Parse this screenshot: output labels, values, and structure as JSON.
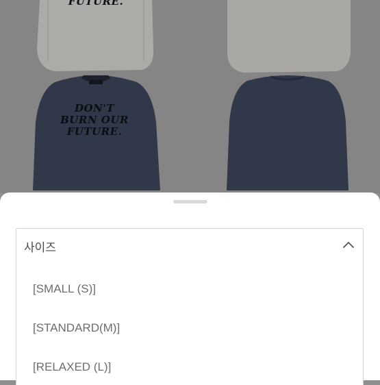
{
  "product_images": {
    "print_lines": [
      "DON'T",
      "BURN OUR",
      "FUTURE."
    ],
    "print_top_fragment": "FUTURE."
  },
  "size_selector": {
    "label": "사이즈",
    "icon": "chevron-up-icon",
    "options": [
      "[SMALL (S)]",
      "[STANDARD(M)]",
      "[RELAXED (L)]"
    ]
  },
  "colors": {
    "sheet": "#ffffff",
    "border": "#d4d4d4",
    "option_text": "#6d6d6d",
    "label_text": "#4a4a4a"
  }
}
